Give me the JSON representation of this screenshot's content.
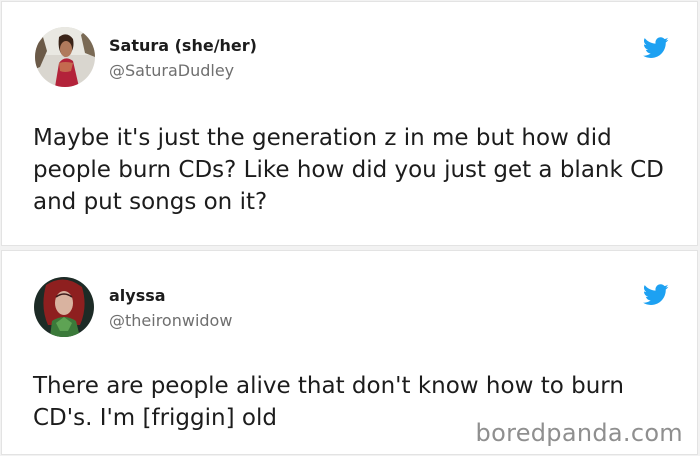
{
  "tweets": [
    {
      "display_name": "Satura (she/her)",
      "handle": "@SaturaDudley",
      "text": "Maybe it's just the generation z in me but how did people burn CDs? Like how did you just get a blank CD and put songs on it?",
      "avatar_icon": "user-avatar",
      "brand_icon": "twitter-bird-icon"
    },
    {
      "display_name": "alyssa",
      "handle": "@theironwidow",
      "text": "There are people alive that don't know how to burn CD's. I'm [friggin] old",
      "avatar_icon": "user-avatar",
      "brand_icon": "twitter-bird-icon"
    }
  ],
  "watermark": "boredpanda.com",
  "colors": {
    "twitter_blue": "#1da1f2",
    "handle_gray": "#6f6f6f",
    "text": "#1c1c1c",
    "watermark_gray": "#8f8f8f"
  }
}
